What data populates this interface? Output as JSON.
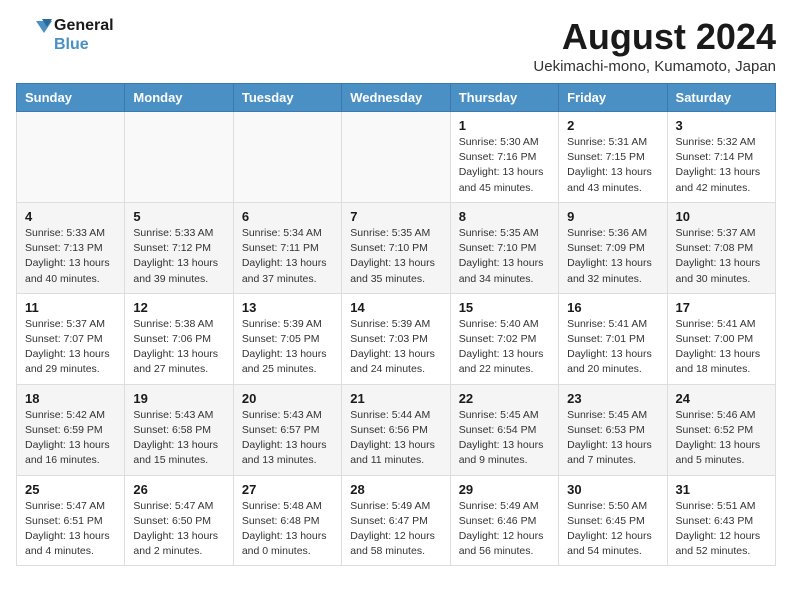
{
  "header": {
    "logo_line1": "General",
    "logo_line2": "Blue",
    "month_year": "August 2024",
    "location": "Uekimachi-mono, Kumamoto, Japan"
  },
  "weekdays": [
    "Sunday",
    "Monday",
    "Tuesday",
    "Wednesday",
    "Thursday",
    "Friday",
    "Saturday"
  ],
  "weeks": [
    [
      {
        "day": "",
        "info": ""
      },
      {
        "day": "",
        "info": ""
      },
      {
        "day": "",
        "info": ""
      },
      {
        "day": "",
        "info": ""
      },
      {
        "day": "1",
        "info": "Sunrise: 5:30 AM\nSunset: 7:16 PM\nDaylight: 13 hours\nand 45 minutes."
      },
      {
        "day": "2",
        "info": "Sunrise: 5:31 AM\nSunset: 7:15 PM\nDaylight: 13 hours\nand 43 minutes."
      },
      {
        "day": "3",
        "info": "Sunrise: 5:32 AM\nSunset: 7:14 PM\nDaylight: 13 hours\nand 42 minutes."
      }
    ],
    [
      {
        "day": "4",
        "info": "Sunrise: 5:33 AM\nSunset: 7:13 PM\nDaylight: 13 hours\nand 40 minutes."
      },
      {
        "day": "5",
        "info": "Sunrise: 5:33 AM\nSunset: 7:12 PM\nDaylight: 13 hours\nand 39 minutes."
      },
      {
        "day": "6",
        "info": "Sunrise: 5:34 AM\nSunset: 7:11 PM\nDaylight: 13 hours\nand 37 minutes."
      },
      {
        "day": "7",
        "info": "Sunrise: 5:35 AM\nSunset: 7:10 PM\nDaylight: 13 hours\nand 35 minutes."
      },
      {
        "day": "8",
        "info": "Sunrise: 5:35 AM\nSunset: 7:10 PM\nDaylight: 13 hours\nand 34 minutes."
      },
      {
        "day": "9",
        "info": "Sunrise: 5:36 AM\nSunset: 7:09 PM\nDaylight: 13 hours\nand 32 minutes."
      },
      {
        "day": "10",
        "info": "Sunrise: 5:37 AM\nSunset: 7:08 PM\nDaylight: 13 hours\nand 30 minutes."
      }
    ],
    [
      {
        "day": "11",
        "info": "Sunrise: 5:37 AM\nSunset: 7:07 PM\nDaylight: 13 hours\nand 29 minutes."
      },
      {
        "day": "12",
        "info": "Sunrise: 5:38 AM\nSunset: 7:06 PM\nDaylight: 13 hours\nand 27 minutes."
      },
      {
        "day": "13",
        "info": "Sunrise: 5:39 AM\nSunset: 7:05 PM\nDaylight: 13 hours\nand 25 minutes."
      },
      {
        "day": "14",
        "info": "Sunrise: 5:39 AM\nSunset: 7:03 PM\nDaylight: 13 hours\nand 24 minutes."
      },
      {
        "day": "15",
        "info": "Sunrise: 5:40 AM\nSunset: 7:02 PM\nDaylight: 13 hours\nand 22 minutes."
      },
      {
        "day": "16",
        "info": "Sunrise: 5:41 AM\nSunset: 7:01 PM\nDaylight: 13 hours\nand 20 minutes."
      },
      {
        "day": "17",
        "info": "Sunrise: 5:41 AM\nSunset: 7:00 PM\nDaylight: 13 hours\nand 18 minutes."
      }
    ],
    [
      {
        "day": "18",
        "info": "Sunrise: 5:42 AM\nSunset: 6:59 PM\nDaylight: 13 hours\nand 16 minutes."
      },
      {
        "day": "19",
        "info": "Sunrise: 5:43 AM\nSunset: 6:58 PM\nDaylight: 13 hours\nand 15 minutes."
      },
      {
        "day": "20",
        "info": "Sunrise: 5:43 AM\nSunset: 6:57 PM\nDaylight: 13 hours\nand 13 minutes."
      },
      {
        "day": "21",
        "info": "Sunrise: 5:44 AM\nSunset: 6:56 PM\nDaylight: 13 hours\nand 11 minutes."
      },
      {
        "day": "22",
        "info": "Sunrise: 5:45 AM\nSunset: 6:54 PM\nDaylight: 13 hours\nand 9 minutes."
      },
      {
        "day": "23",
        "info": "Sunrise: 5:45 AM\nSunset: 6:53 PM\nDaylight: 13 hours\nand 7 minutes."
      },
      {
        "day": "24",
        "info": "Sunrise: 5:46 AM\nSunset: 6:52 PM\nDaylight: 13 hours\nand 5 minutes."
      }
    ],
    [
      {
        "day": "25",
        "info": "Sunrise: 5:47 AM\nSunset: 6:51 PM\nDaylight: 13 hours\nand 4 minutes."
      },
      {
        "day": "26",
        "info": "Sunrise: 5:47 AM\nSunset: 6:50 PM\nDaylight: 13 hours\nand 2 minutes."
      },
      {
        "day": "27",
        "info": "Sunrise: 5:48 AM\nSunset: 6:48 PM\nDaylight: 13 hours\nand 0 minutes."
      },
      {
        "day": "28",
        "info": "Sunrise: 5:49 AM\nSunset: 6:47 PM\nDaylight: 12 hours\nand 58 minutes."
      },
      {
        "day": "29",
        "info": "Sunrise: 5:49 AM\nSunset: 6:46 PM\nDaylight: 12 hours\nand 56 minutes."
      },
      {
        "day": "30",
        "info": "Sunrise: 5:50 AM\nSunset: 6:45 PM\nDaylight: 12 hours\nand 54 minutes."
      },
      {
        "day": "31",
        "info": "Sunrise: 5:51 AM\nSunset: 6:43 PM\nDaylight: 12 hours\nand 52 minutes."
      }
    ]
  ]
}
